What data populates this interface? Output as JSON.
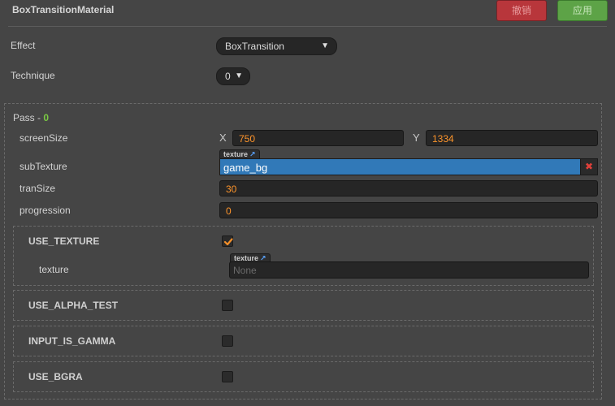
{
  "header": {
    "title": "BoxTransitionMaterial",
    "cancel_label": "撤销",
    "apply_label": "应用"
  },
  "effect": {
    "label": "Effect",
    "value": "BoxTransition"
  },
  "technique": {
    "label": "Technique",
    "value": "0"
  },
  "pass": {
    "label": "Pass - ",
    "index": "0",
    "props": {
      "screenSize": {
        "label": "screenSize",
        "x_axis": "X",
        "x": "750",
        "y_axis": "Y",
        "y": "1334"
      },
      "subTexture": {
        "label": "subTexture",
        "tag": "texture",
        "value": "game_bg"
      },
      "tranSize": {
        "label": "tranSize",
        "value": "30"
      },
      "progression": {
        "label": "progression",
        "value": "0"
      }
    },
    "defines": [
      {
        "name": "USE_TEXTURE",
        "checked": true,
        "child": {
          "label": "texture",
          "tag": "texture",
          "value": "None"
        }
      },
      {
        "name": "USE_ALPHA_TEST",
        "checked": false
      },
      {
        "name": "INPUT_IS_GAMMA",
        "checked": false
      },
      {
        "name": "USE_BGRA",
        "checked": false
      }
    ]
  },
  "colors": {
    "accent_number": "#fd942b",
    "asset_selected": "#3179b8",
    "pass_index": "#7ac943",
    "checkmark": "#f5902a"
  },
  "icons": {
    "dropdown": "triangle-down",
    "link": "external-link",
    "clear": "close-x",
    "check": "checkmark"
  }
}
